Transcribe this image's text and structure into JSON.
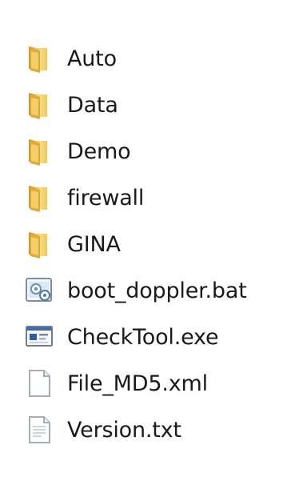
{
  "explorer": {
    "items": [
      {
        "name": "Auto",
        "type": "folder",
        "icon": "folder-icon"
      },
      {
        "name": "Data",
        "type": "folder",
        "icon": "folder-icon"
      },
      {
        "name": "Demo",
        "type": "folder",
        "icon": "folder-icon"
      },
      {
        "name": "firewall",
        "type": "folder",
        "icon": "folder-icon"
      },
      {
        "name": "GINA",
        "type": "folder",
        "icon": "folder-icon"
      },
      {
        "name": "boot_doppler.bat",
        "type": "batch",
        "icon": "batch-file-icon"
      },
      {
        "name": "CheckTool.exe",
        "type": "executable",
        "icon": "executable-icon"
      },
      {
        "name": "File_MD5.xml",
        "type": "xml",
        "icon": "document-icon"
      },
      {
        "name": "Version.txt",
        "type": "text",
        "icon": "text-document-icon"
      }
    ]
  }
}
